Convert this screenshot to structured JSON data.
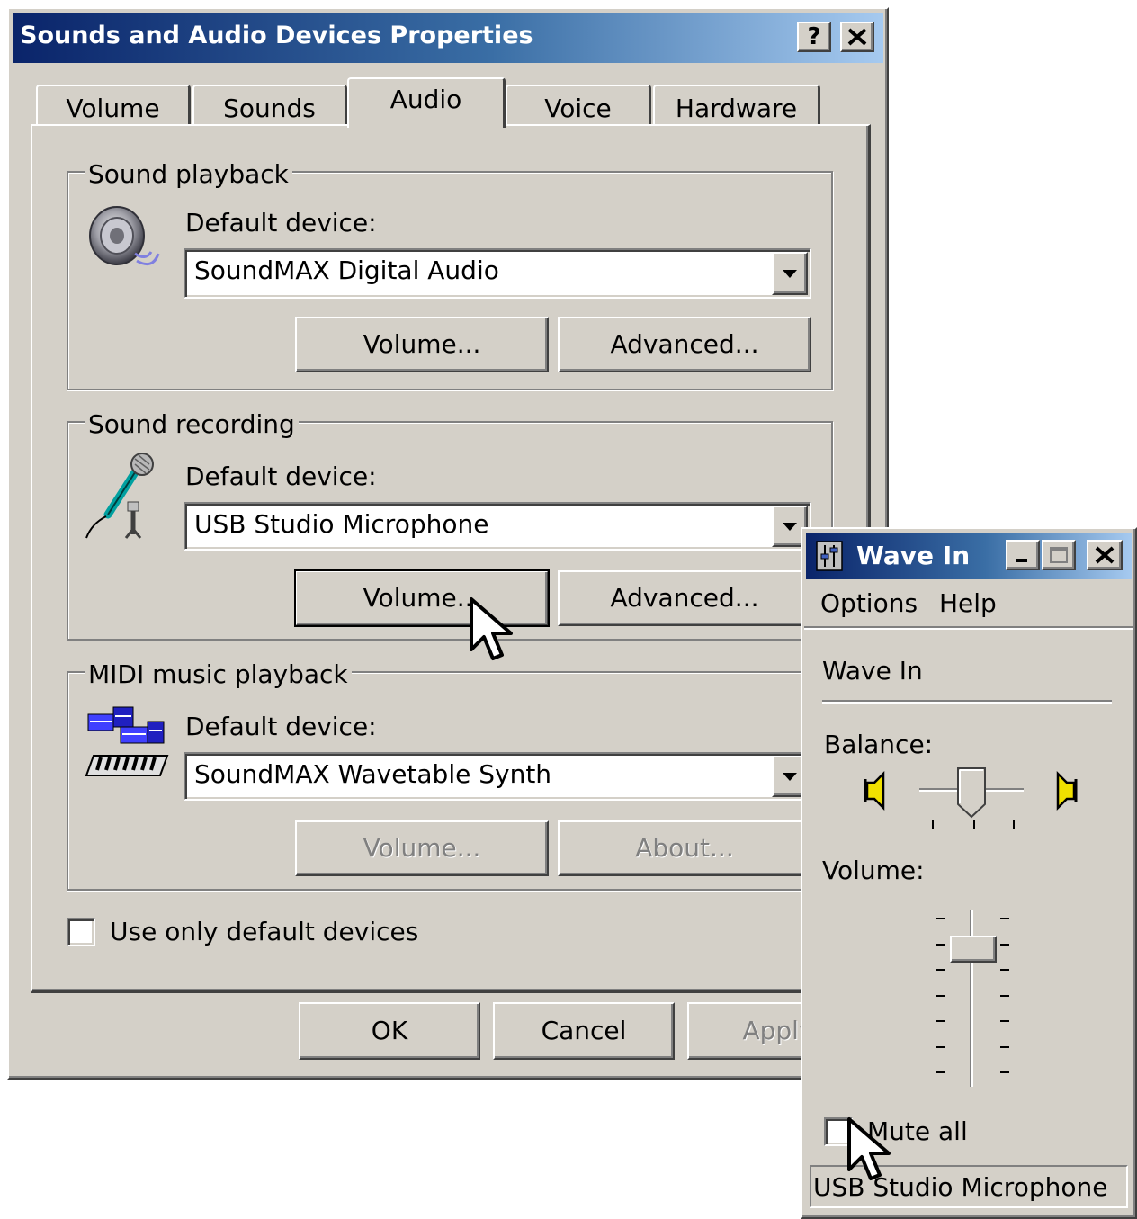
{
  "main_dialog": {
    "title": "Sounds and Audio Devices Properties",
    "help_button": "?",
    "close_button": "✕",
    "tabs": [
      {
        "label": "Volume"
      },
      {
        "label": "Sounds"
      },
      {
        "label": "Audio",
        "active": true
      },
      {
        "label": "Voice"
      },
      {
        "label": "Hardware"
      }
    ],
    "sound_playback": {
      "legend": "Sound playback",
      "default_device_label": "Default device:",
      "device": "SoundMAX Digital Audio",
      "volume_button": "Volume...",
      "advanced_button": "Advanced..."
    },
    "sound_recording": {
      "legend": "Sound recording",
      "default_device_label": "Default device:",
      "device": "USB Studio Microphone",
      "volume_button": "Volume...",
      "advanced_button": "Advanced..."
    },
    "midi_playback": {
      "legend": "MIDI music playback",
      "default_device_label": "Default device:",
      "device": "SoundMAX Wavetable Synth",
      "volume_button": "Volume...",
      "about_button": "About..."
    },
    "use_only_default": {
      "label": "Use only default devices",
      "checked": false
    },
    "ok_button": "OK",
    "cancel_button": "Cancel",
    "apply_button": "Apply"
  },
  "wave_in_window": {
    "title": "Wave In",
    "menu": {
      "options": "Options",
      "help": "Help"
    },
    "section_title": "Wave In",
    "balance_label": "Balance:",
    "volume_label": "Volume:",
    "mute_label": "Mute all",
    "mute_checked": false,
    "status_text": "USB Studio Microphone",
    "balance_value": 0.5,
    "volume_value": 0.83
  },
  "icons": {
    "speaker": "speaker-icon",
    "microphone": "microphone-icon",
    "midi": "midi-keyboard-icon",
    "mixer": "mixer-icon",
    "cursor": "mouse-pointer-icon"
  },
  "colors": {
    "title_gradient_start": "#0a246a",
    "title_gradient_end": "#a6caf0",
    "face": "#d4d0c8"
  }
}
